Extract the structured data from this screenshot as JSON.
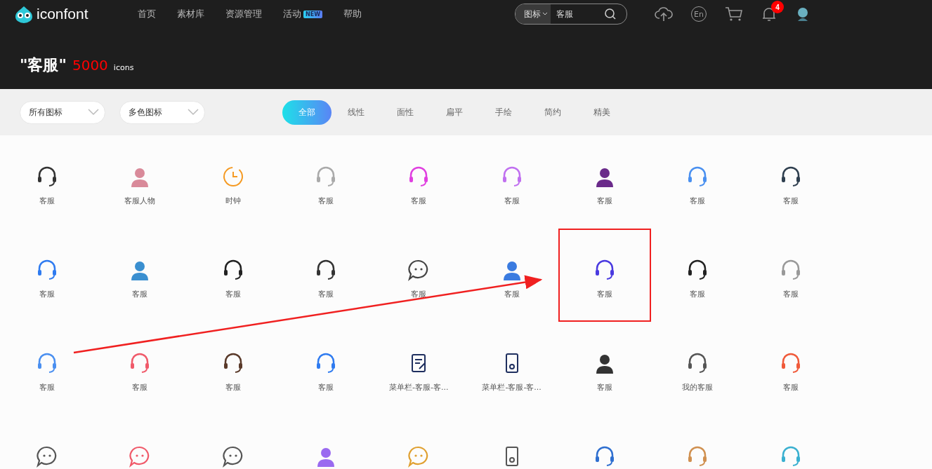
{
  "header": {
    "logo": "iconfont",
    "nav": [
      {
        "label": "首页"
      },
      {
        "label": "素材库"
      },
      {
        "label": "资源管理"
      },
      {
        "label": "活动",
        "badge": "NEW"
      },
      {
        "label": "帮助"
      }
    ],
    "search": {
      "type": "图标",
      "value": "客服"
    },
    "language": "En",
    "notifications": "4"
  },
  "result": {
    "query": "\"客服\"",
    "count": "5000",
    "unit": "icons"
  },
  "filters": {
    "dropdowns": [
      "所有图标",
      "多色图标"
    ],
    "styles": [
      {
        "label": "全部",
        "selected": true
      },
      {
        "label": "线性",
        "selected": false
      },
      {
        "label": "面性",
        "selected": false
      },
      {
        "label": "扁平",
        "selected": false
      },
      {
        "label": "手绘",
        "selected": false
      },
      {
        "label": "简约",
        "selected": false
      },
      {
        "label": "精美",
        "selected": false
      }
    ]
  },
  "icons": [
    {
      "kind": "headset",
      "color": "#333333",
      "name": "客服",
      "highlighted": false
    },
    {
      "kind": "person",
      "color": "#d98a9a",
      "name": "客服人物",
      "highlighted": false
    },
    {
      "kind": "clock",
      "color": "#f59a23",
      "name": "时钟",
      "highlighted": false
    },
    {
      "kind": "headset",
      "color": "#aaaaaa",
      "name": "客服",
      "highlighted": false
    },
    {
      "kind": "headset",
      "color": "#e040e0",
      "name": "客服",
      "highlighted": false
    },
    {
      "kind": "headset",
      "color": "#c070f0",
      "name": "客服",
      "highlighted": false
    },
    {
      "kind": "person",
      "color": "#6a2a8a",
      "name": "客服",
      "highlighted": false
    },
    {
      "kind": "headset",
      "color": "#4a90f0",
      "name": "客服",
      "highlighted": false
    },
    {
      "kind": "headset",
      "color": "#2f3f4f",
      "name": "客服",
      "highlighted": false
    },
    {
      "kind": "headset",
      "color": "#2f7bf0",
      "name": "客服",
      "highlighted": false
    },
    {
      "kind": "person",
      "color": "#3a8fd0",
      "name": "客服",
      "highlighted": false
    },
    {
      "kind": "headset",
      "color": "#222222",
      "name": "客服",
      "highlighted": false
    },
    {
      "kind": "headset",
      "color": "#333333",
      "name": "客服",
      "highlighted": false
    },
    {
      "kind": "chat",
      "color": "#444444",
      "name": "客服",
      "highlighted": false
    },
    {
      "kind": "person",
      "color": "#3a7be0",
      "name": "客服",
      "highlighted": false
    },
    {
      "kind": "headset",
      "color": "#4a3ae0",
      "name": "客服",
      "highlighted": true
    },
    {
      "kind": "headset",
      "color": "#222222",
      "name": "客服",
      "highlighted": false
    },
    {
      "kind": "headset",
      "color": "#999999",
      "name": "客服",
      "highlighted": false
    },
    {
      "kind": "headset",
      "color": "#4a8ff0",
      "name": "客服",
      "highlighted": false
    },
    {
      "kind": "headset",
      "color": "#f05a6a",
      "name": "客服",
      "highlighted": false
    },
    {
      "kind": "headset",
      "color": "#5a3a2a",
      "name": "客服",
      "highlighted": false
    },
    {
      "kind": "headset",
      "color": "#2f7bf0",
      "name": "客服",
      "highlighted": false
    },
    {
      "kind": "document",
      "color": "#1f2f5f",
      "name": "菜单栏-客服-客...",
      "highlighted": false
    },
    {
      "kind": "phone",
      "color": "#1f2f5f",
      "name": "菜单栏-客服-客...",
      "highlighted": false
    },
    {
      "kind": "person",
      "color": "#333333",
      "name": "客服",
      "highlighted": false
    },
    {
      "kind": "headset",
      "color": "#555555",
      "name": "我的客服",
      "highlighted": false
    },
    {
      "kind": "headset",
      "color": "#f05a3a",
      "name": "客服",
      "highlighted": false
    },
    {
      "kind": "chat",
      "color": "#555555",
      "highlighted": false
    },
    {
      "kind": "chat",
      "color": "#f05a6a",
      "highlighted": false
    },
    {
      "kind": "chat",
      "color": "#555555",
      "highlighted": false
    },
    {
      "kind": "person",
      "color": "#9a6af0",
      "highlighted": false
    },
    {
      "kind": "chat",
      "color": "#e0a030",
      "highlighted": false
    },
    {
      "kind": "phone",
      "color": "#555555",
      "highlighted": false
    },
    {
      "kind": "headset",
      "color": "#2f6fd0",
      "highlighted": false
    },
    {
      "kind": "headset",
      "color": "#d09050",
      "highlighted": false
    },
    {
      "kind": "headset",
      "color": "#3ab0d0",
      "highlighted": false
    }
  ],
  "annotation": {
    "arrow": true
  }
}
